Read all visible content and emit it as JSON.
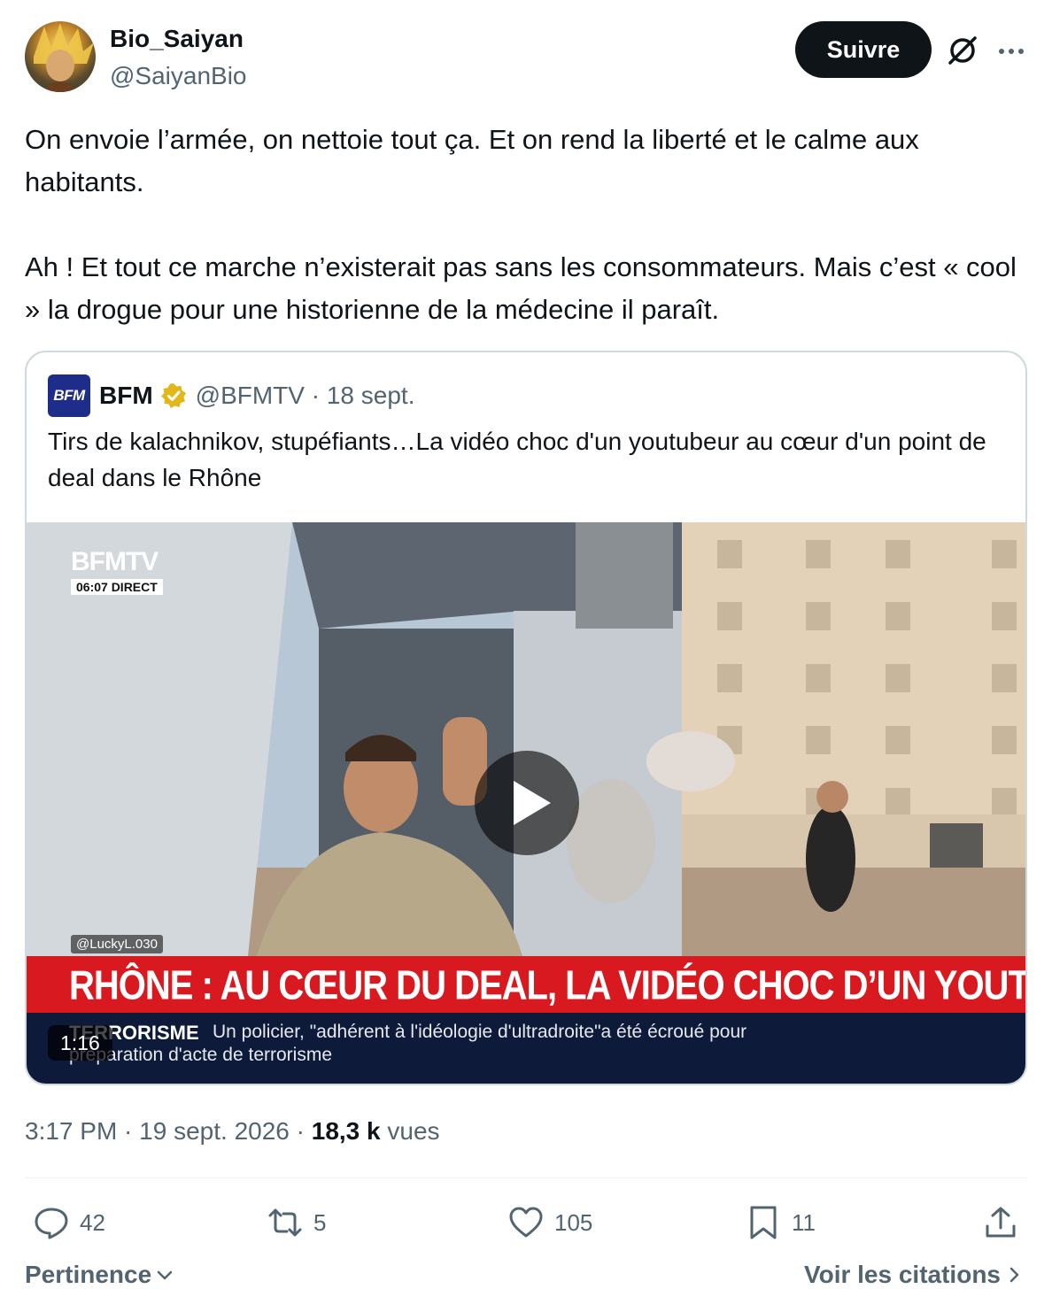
{
  "author": {
    "display_name": "Bio_Saiyan",
    "handle": "@SaiyanBio",
    "follow_label": "Suivre"
  },
  "tweet": {
    "paragraphs": [
      "On envoie l’armée, on nettoie tout ça. Et on rend la liberté et le calme aux habitants.",
      "Ah ! Et tout ce marche n’existerait pas sans les consommateurs. Mais c’est « cool » la drogue pour une historienne de la médecine il paraît."
    ]
  },
  "quote": {
    "logo_text": "BFM",
    "name": "BFM",
    "handle_date": "@BFMTV · 18 sept.",
    "text": "Tirs de kalachnikov, stupéfiants…La vidéo choc d'un youtubeur au cœur d'un point de deal dans le Rhône",
    "video": {
      "channel": "BFMTV",
      "live_label": "06:07  DIRECT",
      "credit": "@LuckyL.030",
      "banner": "RHÔNE : AU CŒUR DU DEAL, LA VIDÉO CHOC D’UN YOUTUBEUR",
      "ticker_label": "TERRORISME",
      "ticker_line1": "Un policier, \"adhérent à l'idéologie d'ultradroite\"a été écroué pour",
      "ticker_line2": "préparation d'acte de terrorisme",
      "duration": "1:16"
    }
  },
  "meta": {
    "time_date": "3:17 PM · 19 sept. 2026 · ",
    "views_count": "18,3 k",
    "views_label": " vues"
  },
  "actions": {
    "replies": "42",
    "reposts": "5",
    "likes": "105",
    "bookmarks": "11"
  },
  "footer": {
    "sort_label": "Pertinence",
    "quotes_link": "Voir les citations"
  },
  "colors": {
    "text_primary": "#0f1419",
    "text_secondary": "#536471",
    "border": "#cfd9de",
    "follow_bg": "#0f1419",
    "verified_gold": "#e2b719",
    "banner_red": "#d8191f",
    "ticker_navy": "#0e1a3a"
  }
}
